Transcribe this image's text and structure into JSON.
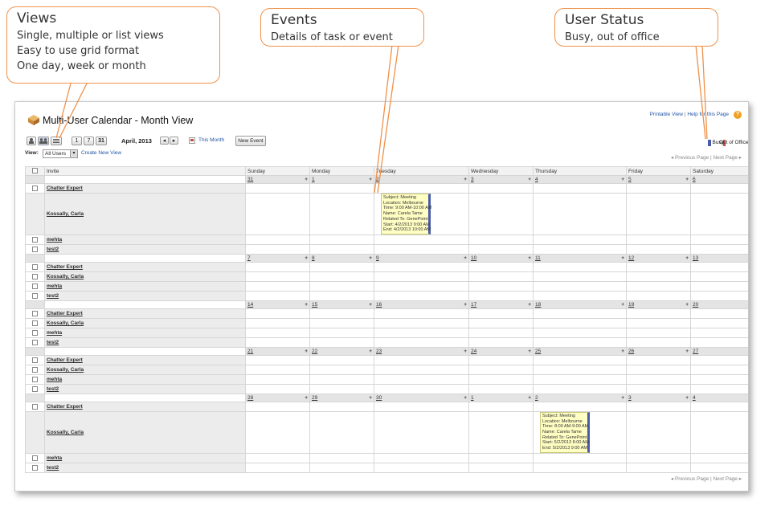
{
  "callouts": {
    "views": {
      "title": "Views",
      "lines": [
        "Single, multiple or list views",
        "Easy to use grid format",
        "One day, week or month"
      ]
    },
    "events": {
      "title": "Events",
      "lines": [
        "Details of task or event"
      ]
    },
    "status": {
      "title": "User Status",
      "lines": [
        "Busy, out of office"
      ]
    }
  },
  "header": {
    "title": "Multi-User Calendar - Month View",
    "printable": "Printable View",
    "help": "Help for this Page",
    "month_label": "April, 2013",
    "this_month": "This Month",
    "new_event": "New Event",
    "view_label": "View:",
    "view_value": "All Users",
    "create_view": "Create New View",
    "prev_page": "Previous Page",
    "next_page": "Next Page",
    "sep": "|",
    "legend_busy": "Busy",
    "legend_ooo": "Out of Office",
    "day_btns": [
      "1",
      "7",
      "31"
    ]
  },
  "colors": {
    "busy": "#4a5ca8",
    "ooo": "#c0504d",
    "accent": "#f0914a"
  },
  "columns": [
    "Invite",
    "Sunday",
    "Monday",
    "Tuesday",
    "Wednesday",
    "Thursday",
    "Friday",
    "Saturday"
  ],
  "users": [
    "Chatter Expert",
    "Kossally, Carla",
    "mehta",
    "test2"
  ],
  "weeks": [
    {
      "days": [
        "31",
        "1",
        "2",
        "3",
        "4",
        "5",
        "6"
      ]
    },
    {
      "days": [
        "7",
        "8",
        "9",
        "10",
        "11",
        "12",
        "13"
      ]
    },
    {
      "days": [
        "14",
        "15",
        "16",
        "17",
        "18",
        "19",
        "20"
      ]
    },
    {
      "days": [
        "21",
        "22",
        "23",
        "24",
        "25",
        "26",
        "27"
      ]
    },
    {
      "days": [
        "28",
        "29",
        "30",
        "1",
        "2",
        "3",
        "4"
      ]
    }
  ],
  "events": [
    {
      "lines": [
        "Subject: Meeting",
        "Location: Melbourne",
        "Time: 9:00 AM-10:00 AM",
        "Name: Carela Tame",
        "Related To: GenePoint",
        "Start: 4/2/2013 9:00 AM",
        "End: 4/2/2013 10:00 AM"
      ]
    },
    {
      "lines": [
        "Subject: Meeting",
        "Location: Melbourne",
        "Time: 8:00 AM-9:00 AM",
        "Name: Carela Tame",
        "Related To: GenePoint",
        "Start: 5/2/2013 8:00 AM",
        "End: 5/2/2013 9:00 AM"
      ]
    }
  ]
}
